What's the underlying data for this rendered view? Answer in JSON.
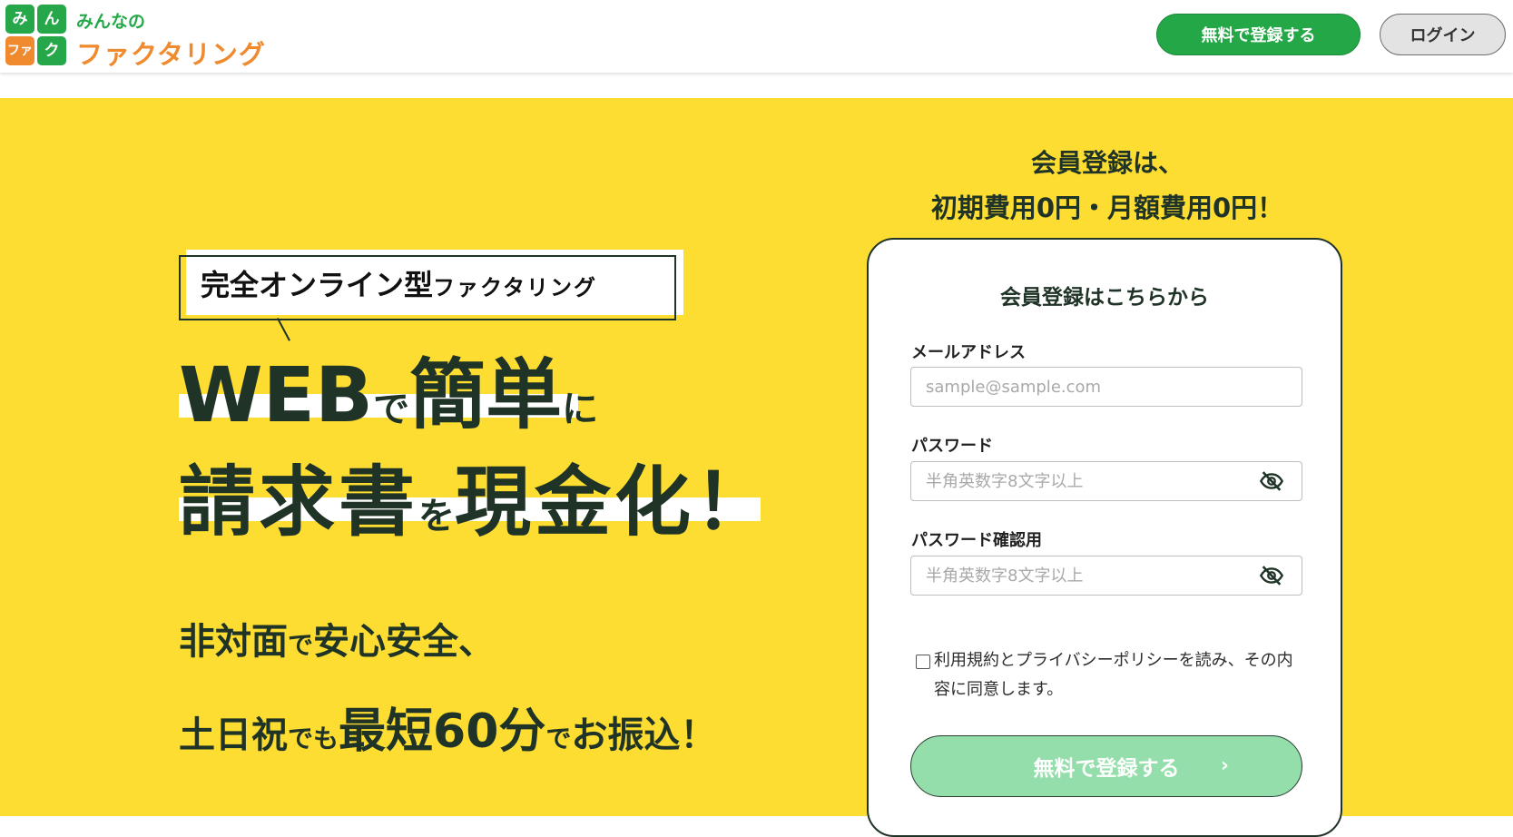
{
  "header": {
    "logo": {
      "tiles": [
        "み",
        "ん",
        "ファ",
        "ク"
      ],
      "small": "みんなの",
      "big": "ファクタリング"
    },
    "register_label": "無料で登録する",
    "login_label": "ログイン"
  },
  "hero": {
    "badge": {
      "bold": "完全オンライン型",
      "rest": "ファクタリング"
    },
    "headline1": {
      "a": "WEB",
      "b": "で",
      "c": "簡単",
      "d": "に"
    },
    "headline2": {
      "a": "請求書",
      "b": "を",
      "c": "現金化！"
    },
    "sub1": {
      "a": "非対面",
      "b": "で",
      "c": "安心安全、"
    },
    "sub2": {
      "a": "土日祝",
      "b": "でも",
      "c": "最短60分",
      "d": "で",
      "e": "お振込！"
    }
  },
  "form": {
    "lead1": "会員登録は、",
    "lead2": "初期費用0円・月額費用0円！",
    "title": "会員登録はこちらから",
    "email_label": "メールアドレス",
    "email_placeholder": "sample@sample.com",
    "password_label": "パスワード",
    "password_placeholder": "半角英数字8文字以上",
    "password_confirm_label": "パスワード確認用",
    "password_confirm_placeholder": "半角英数字8文字以上",
    "agree_text": "利用規約とプライバシーポリシーを読み、その内容に同意します。",
    "submit_label": "無料で登録する",
    "submit_chevron": "›"
  },
  "colors": {
    "yellow": "#fddd31",
    "green": "#24a847",
    "orange": "#f08a2e",
    "dark_green": "#1f3326",
    "submit_green": "#93deaa"
  },
  "icons": {
    "eye": "eye-slash-icon",
    "chevron": "chevron-right-icon"
  }
}
